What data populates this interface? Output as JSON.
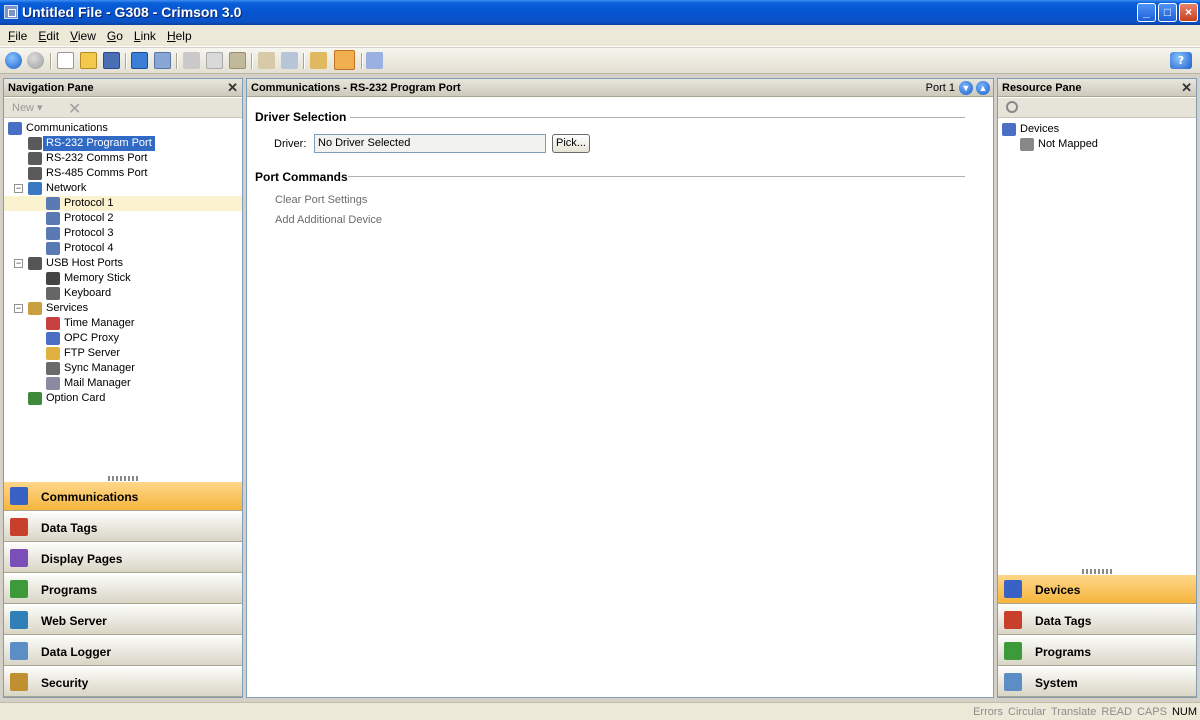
{
  "window": {
    "title": "Untitled File - G308 - Crimson 3.0",
    "buttons": {
      "minimize": "_",
      "maximize": "□",
      "close": "×"
    }
  },
  "menu": [
    "File",
    "Edit",
    "View",
    "Go",
    "Link",
    "Help"
  ],
  "navigation_pane": {
    "title": "Navigation Pane",
    "new_label": "New ▾",
    "tree": [
      {
        "label": "Communications",
        "level": 0,
        "icon": "computer-icon",
        "expanded": true
      },
      {
        "label": "RS-232 Program Port",
        "level": 1,
        "icon": "serial-port-icon",
        "selected": true
      },
      {
        "label": "RS-232 Comms Port",
        "level": 1,
        "icon": "serial-port-icon"
      },
      {
        "label": "RS-485 Comms Port",
        "level": 1,
        "icon": "serial-port-icon"
      },
      {
        "label": "Network",
        "level": 1,
        "icon": "network-icon",
        "expanded": true
      },
      {
        "label": "Protocol 1",
        "level": 2,
        "icon": "protocol-icon",
        "hover": true
      },
      {
        "label": "Protocol 2",
        "level": 2,
        "icon": "protocol-icon"
      },
      {
        "label": "Protocol 3",
        "level": 2,
        "icon": "protocol-icon"
      },
      {
        "label": "Protocol 4",
        "level": 2,
        "icon": "protocol-icon"
      },
      {
        "label": "USB Host Ports",
        "level": 1,
        "icon": "usb-icon",
        "expanded": true
      },
      {
        "label": "Memory Stick",
        "level": 2,
        "icon": "memory-stick-icon"
      },
      {
        "label": "Keyboard",
        "level": 2,
        "icon": "keyboard-icon"
      },
      {
        "label": "Services",
        "level": 1,
        "icon": "services-icon",
        "expanded": true
      },
      {
        "label": "Time Manager",
        "level": 2,
        "icon": "clock-icon"
      },
      {
        "label": "OPC Proxy",
        "level": 2,
        "icon": "opc-icon"
      },
      {
        "label": "FTP Server",
        "level": 2,
        "icon": "folder-icon"
      },
      {
        "label": "Sync Manager",
        "level": 2,
        "icon": "sync-icon"
      },
      {
        "label": "Mail Manager",
        "level": 2,
        "icon": "mail-icon"
      },
      {
        "label": "Option Card",
        "level": 1,
        "icon": "card-icon"
      }
    ],
    "categories": [
      {
        "label": "Communications",
        "active": true,
        "color": "#3a62c4"
      },
      {
        "label": "Data Tags",
        "color": "#c8402c"
      },
      {
        "label": "Display Pages",
        "color": "#7a4fb8"
      },
      {
        "label": "Programs",
        "color": "#3d9a3a"
      },
      {
        "label": "Web Server",
        "color": "#2f7fb8"
      },
      {
        "label": "Data Logger",
        "color": "#5a8ec4"
      },
      {
        "label": "Security",
        "color": "#c09030"
      }
    ]
  },
  "main_pane": {
    "title": "Communications - RS-232 Program Port",
    "port_label": "Port 1",
    "driver_section": "Driver Selection",
    "driver_label": "Driver:",
    "driver_value": "No Driver Selected",
    "pick_label": "Pick...",
    "commands_section": "Port Commands",
    "commands": [
      "Clear Port Settings",
      "Add Additional Device"
    ]
  },
  "resource_pane": {
    "title": "Resource Pane",
    "tree": [
      {
        "label": "Devices",
        "level": 0,
        "icon": "devices-icon"
      },
      {
        "label": "Not Mapped",
        "level": 1,
        "icon": "question-icon"
      }
    ],
    "categories": [
      {
        "label": "Devices",
        "active": true,
        "color": "#3a62c4"
      },
      {
        "label": "Data Tags",
        "color": "#c8402c"
      },
      {
        "label": "Programs",
        "color": "#3d9a3a"
      },
      {
        "label": "System",
        "color": "#5a8ec4"
      }
    ]
  },
  "status_bar": [
    {
      "label": "Errors",
      "on": false
    },
    {
      "label": "Circular",
      "on": false
    },
    {
      "label": "Translate",
      "on": false
    },
    {
      "label": "READ",
      "on": false
    },
    {
      "label": "CAPS",
      "on": false
    },
    {
      "label": "NUM",
      "on": true
    }
  ],
  "colors": {
    "accent": "#316ac5",
    "active_category": "#f5b53c",
    "titlebar": "#0553cf"
  }
}
